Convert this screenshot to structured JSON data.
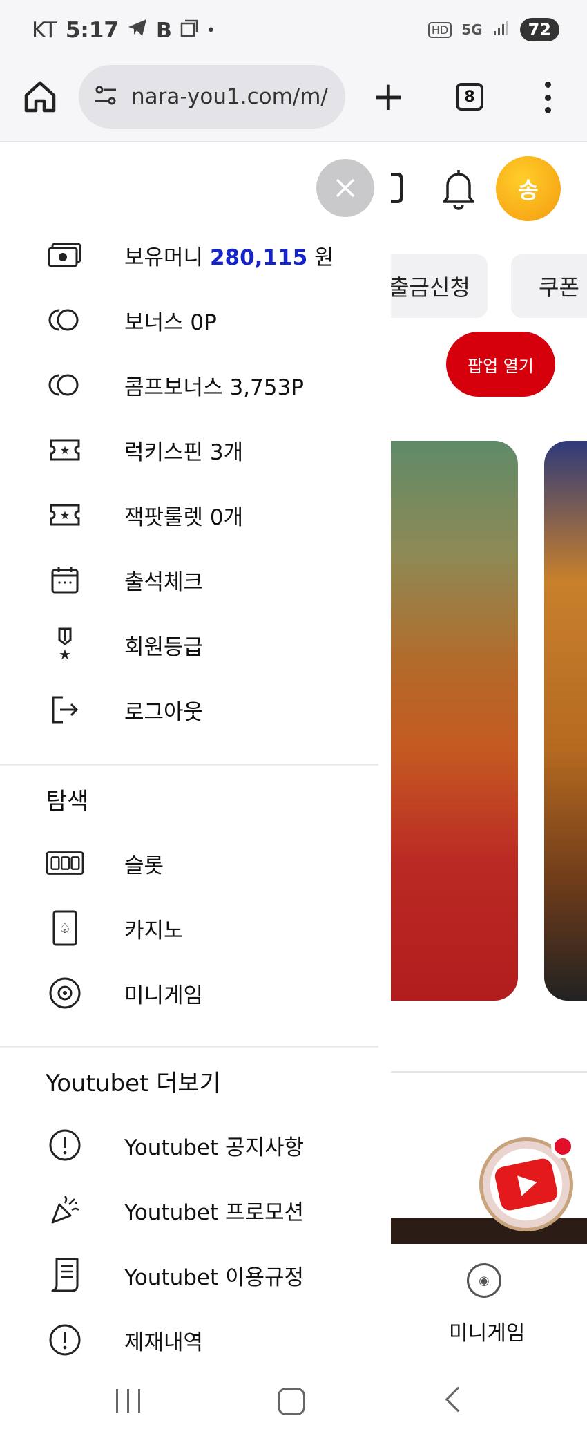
{
  "status_bar": {
    "carrier": "KT",
    "time": "5:17",
    "network": "5G",
    "hd_badge": "HD",
    "battery": "72"
  },
  "browser": {
    "url": "nara-you1.com/m/",
    "tab_count": "8"
  },
  "background_page": {
    "avatar_initial": "송",
    "chip_withdraw": "출금신청",
    "chip_coupon": "쿠폰",
    "popup_button": "팝업 열기",
    "mini_game_label": "미니게임"
  },
  "drawer": {
    "account_items": [
      {
        "icon": "wallet-icon",
        "label_prefix": "보유머니 ",
        "amount": "280,115",
        "label_suffix": " 원"
      },
      {
        "icon": "coins-icon",
        "label": "보너스 0P"
      },
      {
        "icon": "coins-icon",
        "label": "콤프보너스 3,753P"
      },
      {
        "icon": "ticket-icon",
        "label": "럭키스핀 3개"
      },
      {
        "icon": "ticket-icon",
        "label": "잭팟룰렛 0개"
      },
      {
        "icon": "calendar-icon",
        "label": "출석체크"
      },
      {
        "icon": "medal-icon",
        "label": "회원등급"
      },
      {
        "icon": "logout-icon",
        "label": "로그아웃"
      }
    ],
    "explore": {
      "title": "탐색",
      "items": [
        {
          "icon": "slot-icon",
          "label": "슬롯"
        },
        {
          "icon": "card-icon",
          "label": "카지노"
        },
        {
          "icon": "chip-icon",
          "label": "미니게임"
        }
      ]
    },
    "more": {
      "title": "Youtubet 더보기",
      "items": [
        {
          "icon": "notice-icon",
          "label": "Youtubet 공지사항"
        },
        {
          "icon": "party-icon",
          "label": "Youtubet 프로모션"
        },
        {
          "icon": "document-icon",
          "label": "Youtubet 이용규정"
        },
        {
          "icon": "notice-icon",
          "label": "제재내역"
        }
      ]
    }
  },
  "colors": {
    "accent_money": "#1424c9",
    "popup_red": "#d5000c",
    "avatar_orange": "#f59b0f"
  }
}
